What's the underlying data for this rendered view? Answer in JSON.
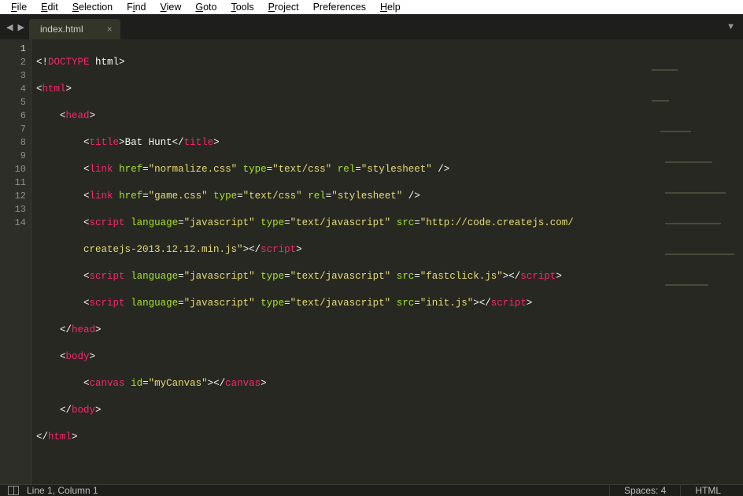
{
  "colors": {
    "accent_pink": "#f92672",
    "accent_green": "#a6e22e",
    "accent_yellow": "#e6db74",
    "bg": "#272822"
  },
  "menu": {
    "file": {
      "u": "F",
      "rest": "ile"
    },
    "edit": {
      "u": "E",
      "rest": "dit"
    },
    "selection": {
      "u": "S",
      "rest": "election"
    },
    "find": {
      "u": "F",
      "middle": "i",
      "rest": "nd"
    },
    "view": {
      "u": "V",
      "rest": "iew"
    },
    "goto": {
      "u": "G",
      "rest": "oto"
    },
    "tools": {
      "u": "T",
      "rest": "ools"
    },
    "project": {
      "u": "P",
      "rest": "roject"
    },
    "prefs": {
      "u": "",
      "label": "Preferences"
    },
    "help": {
      "u": "H",
      "rest": "elp"
    }
  },
  "tabs": {
    "active": {
      "label": "index.html",
      "close": "×"
    }
  },
  "code": {
    "lines": [
      "1",
      "2",
      "3",
      "4",
      "5",
      "6",
      "7",
      "8",
      "9",
      "10",
      "11",
      "12",
      "13",
      "14"
    ],
    "l1": {
      "open": "<!",
      "kw": "DOCTYPE",
      "sp": " ",
      "txt": "html",
      "close": ">"
    },
    "l2": {
      "open": "<",
      "tag": "html",
      "close": ">"
    },
    "l3": {
      "open": "<",
      "tag": "head",
      "close": ">"
    },
    "l4": {
      "open": "<",
      "tag": "title",
      "close": ">",
      "text": "Bat Hunt",
      "open2": "</",
      "tag2": "title",
      "close2": ">"
    },
    "l5": {
      "open": "<",
      "tag": "link",
      "a1n": "href",
      "a1v": "\"normalize.css\"",
      "a2n": "type",
      "a2v": "\"text/css\"",
      "a3n": "rel",
      "a3v": "\"stylesheet\"",
      "selfclose": " />"
    },
    "l6": {
      "open": "<",
      "tag": "link",
      "a1n": "href",
      "a1v": "\"game.css\"",
      "a2n": "type",
      "a2v": "\"text/css\"",
      "a3n": "rel",
      "a3v": "\"stylesheet\"",
      "selfclose": " />"
    },
    "l7a": {
      "open": "<",
      "tag": "script",
      "a1n": "language",
      "a1v": "\"javascript\"",
      "a2n": "type",
      "a2v": "\"text/javascript\"",
      "a3n": "src",
      "a3v": "\"http://code.createjs.com/"
    },
    "l7b": {
      "cont": "createjs-2013.12.12.min.js\"",
      "close": ">",
      "open2": "</",
      "tag2": "script",
      "close2": ">"
    },
    "l8": {
      "open": "<",
      "tag": "script",
      "a1n": "language",
      "a1v": "\"javascript\"",
      "a2n": "type",
      "a2v": "\"text/javascript\"",
      "a3n": "src",
      "a3v": "\"fastclick.js\"",
      "close": ">",
      "open2": "</",
      "tag2": "script",
      "close2": ">"
    },
    "l9": {
      "open": "<",
      "tag": "script",
      "a1n": "language",
      "a1v": "\"javascript\"",
      "a2n": "type",
      "a2v": "\"text/javascript\"",
      "a3n": "src",
      "a3v": "\"init.js\"",
      "close": ">",
      "open2": "</",
      "tag2": "script",
      "close2": ">"
    },
    "l10": {
      "open": "</",
      "tag": "head",
      "close": ">"
    },
    "l11": {
      "open": "<",
      "tag": "body",
      "close": ">"
    },
    "l12": {
      "open": "<",
      "tag": "canvas",
      "a1n": "id",
      "a1v": "\"myCanvas\"",
      "close": ">",
      "open2": "</",
      "tag2": "canvas",
      "close2": ">"
    },
    "l13": {
      "open": "</",
      "tag": "body",
      "close": ">"
    },
    "l14": {
      "open": "</",
      "tag": "html",
      "close": ">"
    }
  },
  "status": {
    "cursor": "Line 1, Column 1",
    "indent": "Spaces: 4",
    "syntax": "HTML"
  }
}
